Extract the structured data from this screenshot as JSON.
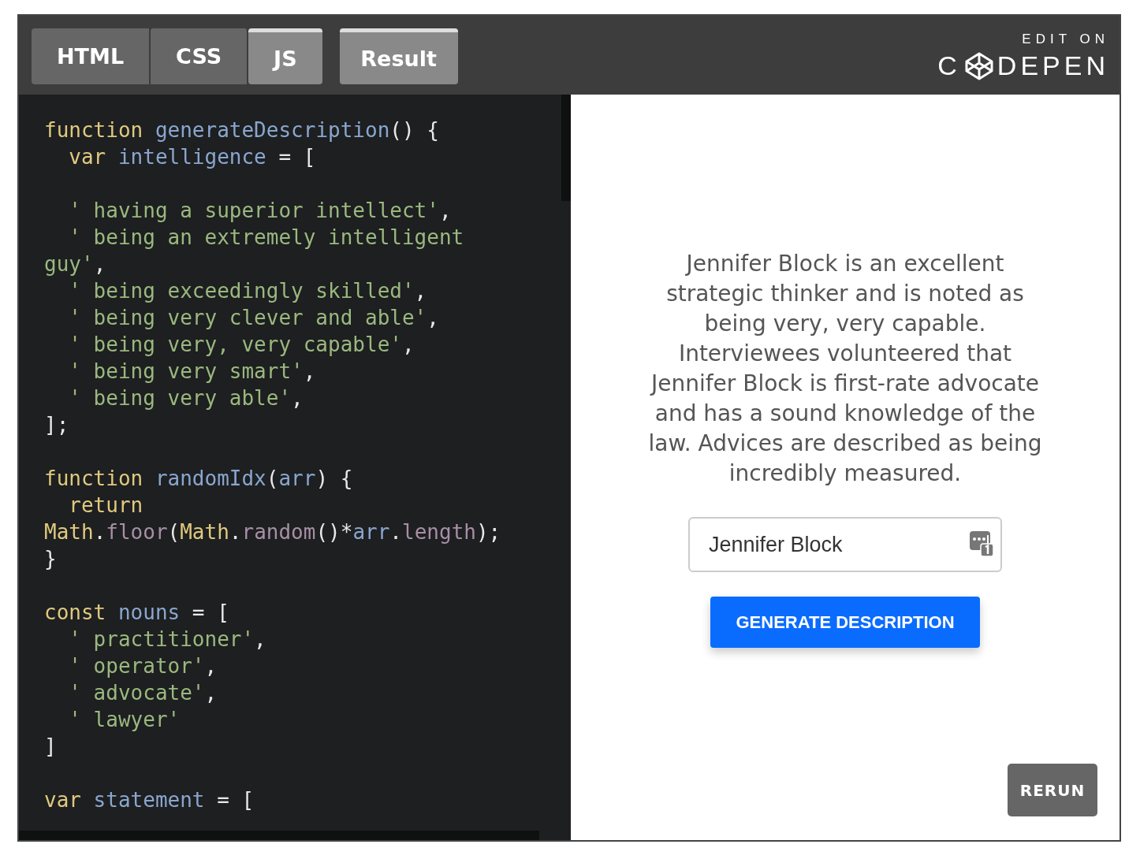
{
  "tabs": [
    {
      "label": "HTML",
      "selected": false
    },
    {
      "label": "CSS",
      "selected": false
    },
    {
      "label": "JS",
      "selected": true
    }
  ],
  "result_tab": {
    "label": "Result",
    "selected": true
  },
  "logo": {
    "caption": "EDIT ON",
    "prefix": "C",
    "suffix": "DEPEN"
  },
  "code_lines": [
    {
      "kind": "code",
      "tokens": [
        {
          "kind": "keyword",
          "text": "function"
        },
        {
          "kind": "name",
          "text": " generateDescription"
        },
        {
          "kind": "punct",
          "text": "() {"
        }
      ]
    },
    {
      "kind": "code",
      "tokens": [
        {
          "kind": "keyword",
          "text": "  var"
        },
        {
          "kind": "name",
          "text": " intelligence"
        },
        {
          "kind": "punct",
          "text": " = ["
        }
      ]
    },
    {
      "kind": "blank"
    },
    {
      "kind": "code",
      "tokens": [
        {
          "kind": "string",
          "text": "  ' having a superior intellect'"
        },
        {
          "kind": "punct",
          "text": ","
        }
      ]
    },
    {
      "kind": "code",
      "tokens": [
        {
          "kind": "string",
          "text": "  ' being an extremely intelligent"
        }
      ]
    },
    {
      "kind": "code",
      "tokens": [
        {
          "kind": "string",
          "text": "guy'"
        },
        {
          "kind": "punct",
          "text": ","
        }
      ]
    },
    {
      "kind": "code",
      "tokens": [
        {
          "kind": "string",
          "text": "  ' being exceedingly skilled'"
        },
        {
          "kind": "punct",
          "text": ","
        }
      ]
    },
    {
      "kind": "code",
      "tokens": [
        {
          "kind": "string",
          "text": "  ' being very clever and able'"
        },
        {
          "kind": "punct",
          "text": ","
        }
      ]
    },
    {
      "kind": "code",
      "tokens": [
        {
          "kind": "string",
          "text": "  ' being very, very capable'"
        },
        {
          "kind": "punct",
          "text": ","
        }
      ]
    },
    {
      "kind": "code",
      "tokens": [
        {
          "kind": "string",
          "text": "  ' being very smart'"
        },
        {
          "kind": "punct",
          "text": ","
        }
      ]
    },
    {
      "kind": "code",
      "tokens": [
        {
          "kind": "string",
          "text": "  ' being very able'"
        },
        {
          "kind": "punct",
          "text": ","
        }
      ]
    },
    {
      "kind": "code",
      "tokens": [
        {
          "kind": "punct",
          "text": "];"
        }
      ]
    },
    {
      "kind": "blank"
    },
    {
      "kind": "code",
      "tokens": [
        {
          "kind": "keyword",
          "text": "function"
        },
        {
          "kind": "name",
          "text": " randomIdx"
        },
        {
          "kind": "punct",
          "text": "("
        },
        {
          "kind": "name",
          "text": "arr"
        },
        {
          "kind": "punct",
          "text": ") {"
        }
      ]
    },
    {
      "kind": "code",
      "tokens": [
        {
          "kind": "keyword",
          "text": "  return"
        }
      ]
    },
    {
      "kind": "code",
      "tokens": [
        {
          "kind": "keyword",
          "text": "Math"
        },
        {
          "kind": "punct",
          "text": "."
        },
        {
          "kind": "property",
          "text": "floor"
        },
        {
          "kind": "punct",
          "text": "("
        },
        {
          "kind": "keyword",
          "text": "Math"
        },
        {
          "kind": "punct",
          "text": "."
        },
        {
          "kind": "property",
          "text": "random"
        },
        {
          "kind": "punct",
          "text": "()*"
        },
        {
          "kind": "name",
          "text": "arr"
        },
        {
          "kind": "punct",
          "text": "."
        },
        {
          "kind": "property",
          "text": "length"
        },
        {
          "kind": "punct",
          "text": ");"
        }
      ]
    },
    {
      "kind": "code",
      "tokens": [
        {
          "kind": "punct",
          "text": "}"
        }
      ]
    },
    {
      "kind": "blank"
    },
    {
      "kind": "code",
      "tokens": [
        {
          "kind": "keyword",
          "text": "const"
        },
        {
          "kind": "name",
          "text": " nouns"
        },
        {
          "kind": "punct",
          "text": " = ["
        }
      ]
    },
    {
      "kind": "code",
      "tokens": [
        {
          "kind": "string",
          "text": "  ' practitioner'"
        },
        {
          "kind": "punct",
          "text": ","
        }
      ]
    },
    {
      "kind": "code",
      "tokens": [
        {
          "kind": "string",
          "text": "  ' operator'"
        },
        {
          "kind": "punct",
          "text": ","
        }
      ]
    },
    {
      "kind": "code",
      "tokens": [
        {
          "kind": "string",
          "text": "  ' advocate'"
        },
        {
          "kind": "punct",
          "text": ","
        }
      ]
    },
    {
      "kind": "code",
      "tokens": [
        {
          "kind": "string",
          "text": "  ' lawyer'"
        }
      ]
    },
    {
      "kind": "code",
      "tokens": [
        {
          "kind": "punct",
          "text": "]"
        }
      ]
    },
    {
      "kind": "blank"
    },
    {
      "kind": "code",
      "tokens": [
        {
          "kind": "keyword",
          "text": "var"
        },
        {
          "kind": "name",
          "text": " statement"
        },
        {
          "kind": "punct",
          "text": " = ["
        }
      ]
    }
  ],
  "result": {
    "description": "Jennifer Block is an excellent strategic thinker and is noted as being very, very capable. Interviewees volunteered that Jennifer Block is first-rate advocate and has a sound knowledge of the law. Advices are described as being incredibly measured.",
    "name_field": {
      "value": "Jennifer Block"
    },
    "generate_button": "GENERATE DESCRIPTION"
  },
  "rerun_button": "RERUN"
}
